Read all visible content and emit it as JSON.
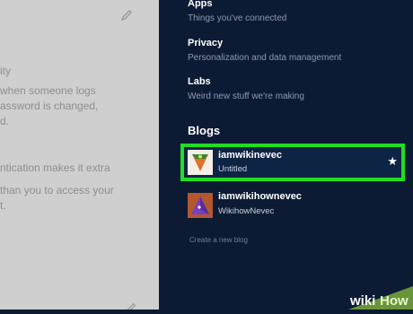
{
  "left_panel": {
    "lines": [
      "ity",
      "when someone logs",
      "assword is changed,",
      "d.",
      "ntication makes it extra",
      "than you to access your",
      "t."
    ]
  },
  "menu": {
    "items": [
      {
        "title": "Apps",
        "subtitle": "Things you've connected"
      },
      {
        "title": "Privacy",
        "subtitle": "Personalization and data management"
      },
      {
        "title": "Labs",
        "subtitle": "Weird new stuff we're making"
      }
    ]
  },
  "blogs": {
    "heading": "Blogs",
    "items": [
      {
        "name": "iamwikinevec",
        "subtitle": "Untitled",
        "selected": true
      },
      {
        "name": "iamwikihownevec",
        "subtitle": "WikihowNevec",
        "selected": false
      }
    ],
    "create_label": "Create a new blog"
  },
  "watermark": {
    "text_a": "wiki",
    "text_b": "How"
  },
  "colors": {
    "highlight": "#22dd22",
    "panel_bg": "#0c1b33",
    "left_bg": "#cfcfcf"
  }
}
